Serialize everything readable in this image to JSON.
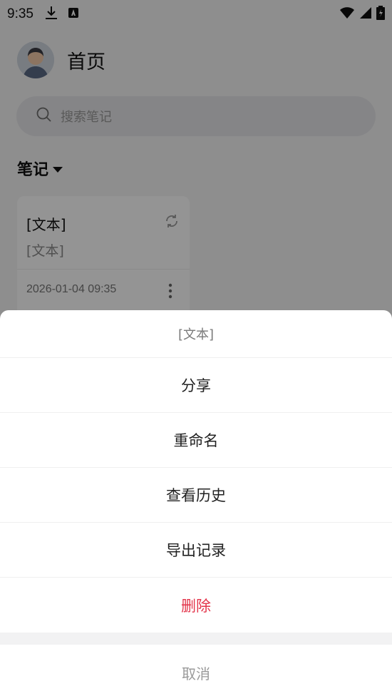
{
  "status_bar": {
    "time": "9:35",
    "icons": [
      "download-icon",
      "app-notification-icon",
      "wifi-icon",
      "signal-icon",
      "battery-icon"
    ]
  },
  "header": {
    "title": "首页"
  },
  "search": {
    "placeholder": "搜索笔记"
  },
  "section": {
    "title": "笔记"
  },
  "note": {
    "title": "[文本]",
    "preview": "[文本]",
    "date": "2026-01-04 09:35"
  },
  "sheet": {
    "title": "[文本]",
    "items": [
      {
        "label": "分享"
      },
      {
        "label": "重命名"
      },
      {
        "label": "查看历史"
      },
      {
        "label": "导出记录"
      },
      {
        "label": "删除"
      }
    ],
    "cancel": "取消"
  },
  "colors": {
    "danger": "#e3344a",
    "overlay": "rgba(0,0,0,0.42)"
  }
}
